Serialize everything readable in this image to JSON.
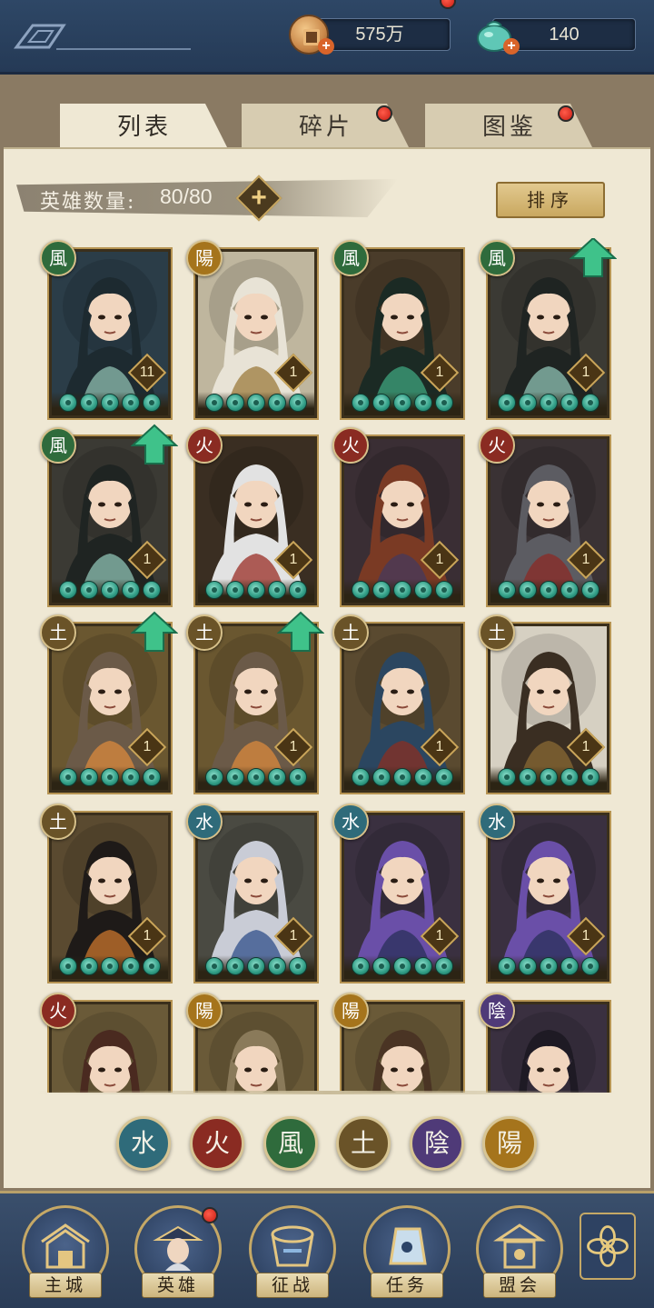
{
  "resources": {
    "coins": "575万",
    "jade": "140"
  },
  "tabs": [
    {
      "label": "列表",
      "active": true,
      "badge": false
    },
    {
      "label": "碎片",
      "active": false,
      "badge": true
    },
    {
      "label": "图鉴",
      "active": false,
      "badge": true
    }
  ],
  "hero_count": {
    "label": "英雄数量:",
    "value": "80/80"
  },
  "sort_label": "排序",
  "element_colors": {
    "water": "#2f6b7a",
    "fire": "#8a2b22",
    "wind": "#2f6b3c",
    "earth": "#6a5328",
    "yin": "#4f3a78",
    "yang": "#a5741c"
  },
  "heroes": [
    {
      "element": "wind",
      "glyph": "風",
      "level": "11",
      "upgrade": false,
      "palette": [
        "#2b3d48",
        "#1d2a30",
        "#8fbfb0"
      ]
    },
    {
      "element": "yang",
      "glyph": "陽",
      "level": "1",
      "upgrade": false,
      "palette": [
        "#bfb69e",
        "#e8e3d6",
        "#9c7b3c"
      ]
    },
    {
      "element": "wind",
      "glyph": "風",
      "level": "1",
      "upgrade": false,
      "palette": [
        "#4a3c2a",
        "#1b2a24",
        "#3fa47d"
      ]
    },
    {
      "element": "wind",
      "glyph": "風",
      "level": "1",
      "upgrade": true,
      "palette": [
        "#3b3a34",
        "#1f2422",
        "#8fc2b4"
      ]
    },
    {
      "element": "wind",
      "glyph": "風",
      "level": "1",
      "upgrade": true,
      "palette": [
        "#3b3a34",
        "#1f2422",
        "#8fc2b4"
      ]
    },
    {
      "element": "fire",
      "glyph": "火",
      "level": "1",
      "upgrade": false,
      "palette": [
        "#3a2e22",
        "#e2e2e2",
        "#9a2d25"
      ]
    },
    {
      "element": "fire",
      "glyph": "火",
      "level": "1",
      "upgrade": false,
      "palette": [
        "#3a2e34",
        "#7a3a24",
        "#463a5c"
      ]
    },
    {
      "element": "fire",
      "glyph": "火",
      "level": "1",
      "upgrade": false,
      "palette": [
        "#3a3234",
        "#5c5c62",
        "#8b2a25"
      ]
    },
    {
      "element": "earth",
      "glyph": "土",
      "level": "1",
      "upgrade": true,
      "palette": [
        "#6a5730",
        "#6b5a48",
        "#d98a3c"
      ]
    },
    {
      "element": "earth",
      "glyph": "土",
      "level": "1",
      "upgrade": true,
      "palette": [
        "#6a5730",
        "#6b5a48",
        "#d98a3c"
      ]
    },
    {
      "element": "earth",
      "glyph": "土",
      "level": "1",
      "upgrade": false,
      "palette": [
        "#5a4a30",
        "#2b4660",
        "#8a2f22"
      ]
    },
    {
      "element": "earth",
      "glyph": "土",
      "level": "1",
      "upgrade": false,
      "palette": [
        "#d6d0c2",
        "#3a2e22",
        "#8a6a34"
      ]
    },
    {
      "element": "earth",
      "glyph": "土",
      "level": "1",
      "upgrade": false,
      "palette": [
        "#5a4a30",
        "#1e1a18",
        "#c9762c"
      ]
    },
    {
      "element": "water",
      "glyph": "水",
      "level": "1",
      "upgrade": false,
      "palette": [
        "#4a4a42",
        "#c9ccd6",
        "#2f4f8a"
      ]
    },
    {
      "element": "water",
      "glyph": "水",
      "level": "1",
      "upgrade": false,
      "palette": [
        "#3a3040",
        "#6a4fa8",
        "#2a2f5a"
      ]
    },
    {
      "element": "water",
      "glyph": "水",
      "level": "1",
      "upgrade": false,
      "palette": [
        "#3a3040",
        "#6a4fa8",
        "#2a2f5a"
      ]
    },
    {
      "element": "fire",
      "glyph": "火",
      "level": "",
      "upgrade": false,
      "palette": [
        "#6a5a38",
        "#4a2a20",
        "#e6c3a4"
      ]
    },
    {
      "element": "yang",
      "glyph": "陽",
      "level": "",
      "upgrade": false,
      "palette": [
        "#6a5a38",
        "#8a7a5a",
        "#e6d6b4"
      ]
    },
    {
      "element": "yang",
      "glyph": "陽",
      "level": "",
      "upgrade": false,
      "palette": [
        "#6a5a38",
        "#4a3424",
        "#e2c0a0"
      ]
    },
    {
      "element": "yin",
      "glyph": "陰",
      "level": "",
      "upgrade": false,
      "palette": [
        "#3a3040",
        "#1e1a24",
        "#d2b8a8"
      ]
    }
  ],
  "filters": [
    {
      "element": "water",
      "glyph": "水"
    },
    {
      "element": "fire",
      "glyph": "火"
    },
    {
      "element": "wind",
      "glyph": "風"
    },
    {
      "element": "earth",
      "glyph": "土"
    },
    {
      "element": "yin",
      "glyph": "陰"
    },
    {
      "element": "yang",
      "glyph": "陽"
    }
  ],
  "nav": [
    {
      "label": "主城",
      "icon": "city-gate-icon",
      "badge": false,
      "active": false
    },
    {
      "label": "英雄",
      "icon": "hero-portrait-icon",
      "badge": true,
      "active": true
    },
    {
      "label": "征战",
      "icon": "battle-drum-icon",
      "badge": false,
      "active": false
    },
    {
      "label": "任务",
      "icon": "task-bell-icon",
      "badge": false,
      "active": false
    },
    {
      "label": "盟会",
      "icon": "guild-hall-icon",
      "badge": false,
      "active": false
    }
  ]
}
